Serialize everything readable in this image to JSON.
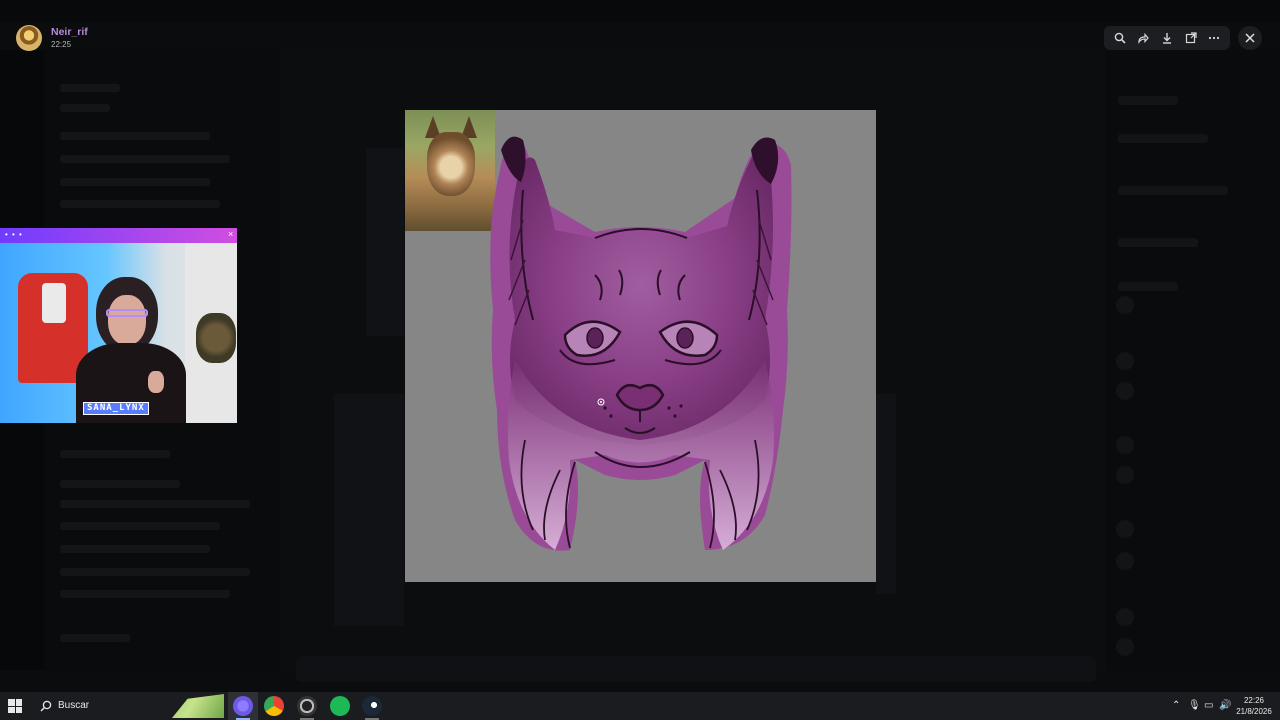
{
  "author": {
    "name": "Neir_rif",
    "time": "22:25"
  },
  "toolbar": {
    "zoom": "zoom-icon",
    "forward": "forward-icon",
    "download": "download-icon",
    "open_in_browser": "open-external-icon",
    "more": "more-icon",
    "close": "close-icon"
  },
  "webcam": {
    "dots": "• • •",
    "close": "×",
    "name_tag": "SANA_LYNX"
  },
  "taskbar": {
    "search_label": "Buscar",
    "time": "22:26",
    "date": "21/8/2026"
  },
  "colors": {
    "artwork_background": "#868686",
    "lynx_purple": "#8a3f86",
    "accent_username": "#b58cd8",
    "webcam_border": "#c040d8"
  }
}
